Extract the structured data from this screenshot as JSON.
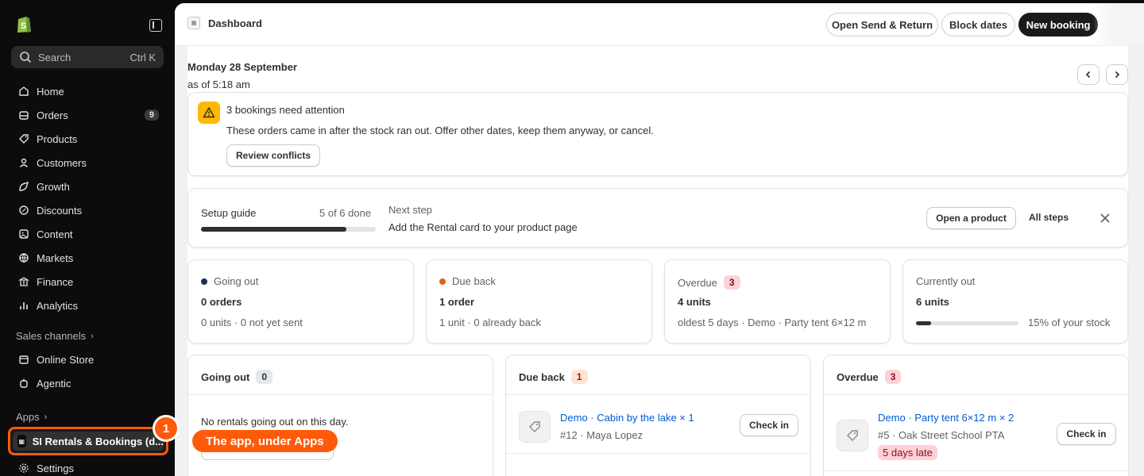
{
  "sidebar": {
    "search_placeholder": "Search",
    "search_shortcut": "Ctrl K",
    "items": [
      {
        "label": "Home",
        "icon": "home-icon"
      },
      {
        "label": "Orders",
        "icon": "orders-icon",
        "count": "9"
      },
      {
        "label": "Products",
        "icon": "products-icon"
      },
      {
        "label": "Customers",
        "icon": "customers-icon"
      },
      {
        "label": "Growth",
        "icon": "growth-icon"
      },
      {
        "label": "Discounts",
        "icon": "discounts-icon"
      },
      {
        "label": "Content",
        "icon": "content-icon"
      },
      {
        "label": "Markets",
        "icon": "markets-icon"
      },
      {
        "label": "Finance",
        "icon": "finance-icon"
      },
      {
        "label": "Analytics",
        "icon": "analytics-icon"
      }
    ],
    "sales_channels_label": "Sales channels",
    "channels": [
      {
        "label": "Online Store",
        "icon": "online-store-icon"
      },
      {
        "label": "Agentic",
        "icon": "agentic-icon"
      }
    ],
    "apps_label": "Apps",
    "app_item": "SI Rentals & Bookings (d...",
    "settings": "Settings"
  },
  "annotation": {
    "step": "1",
    "label": "The app, under Apps",
    "color": "#ff5a0a"
  },
  "header": {
    "title": "Dashboard",
    "buttons": {
      "send_return": "Open Send & Return",
      "block_dates": "Block dates",
      "new_booking": "New booking"
    }
  },
  "date": {
    "title": "Monday 28 September",
    "sub": "as of 5:18 am"
  },
  "attention": {
    "title": "3 bookings need attention",
    "text": "These orders came in after the stock ran out. Offer other dates, keep them anyway, or cancel.",
    "button": "Review conflicts"
  },
  "setup": {
    "title": "Setup guide",
    "progress_text": "5 of 6 done",
    "progress": 0.833,
    "next_label": "Next step",
    "next_text": "Add the Rental card to your product page",
    "open_product": "Open a product",
    "all_steps": "All steps"
  },
  "stats": [
    {
      "title": "Going out",
      "dot": "#1f2d4e",
      "value": "0 orders",
      "sub": "0 units · 0 not yet sent"
    },
    {
      "title": "Due back",
      "dot": "#e85c13",
      "value": "1 order",
      "sub": "1 unit · 0 already back"
    },
    {
      "title": "Overdue",
      "badge": "3",
      "value": "4 units",
      "sub": "oldest 5 days · Demo · Party tent 6×12 m"
    },
    {
      "title": "Currently out",
      "value": "6 units",
      "progress": 0.15,
      "sub": "15% of your stock"
    }
  ],
  "columns": {
    "going_out": {
      "title": "Going out",
      "count": "0",
      "empty": "No rentals going out on this day."
    },
    "due_back": {
      "title": "Due back",
      "count": "1",
      "item": {
        "link": "Demo · Cabin by the lake × 1",
        "meta": "#12 · Maya Lopez",
        "button": "Check in"
      }
    },
    "overdue": {
      "title": "Overdue",
      "count": "3",
      "item": {
        "link": "Demo · Party tent 6×12 m × 2",
        "meta": "#5 · Oak Street School PTA",
        "late": "5 days late",
        "button": "Check in"
      }
    }
  }
}
